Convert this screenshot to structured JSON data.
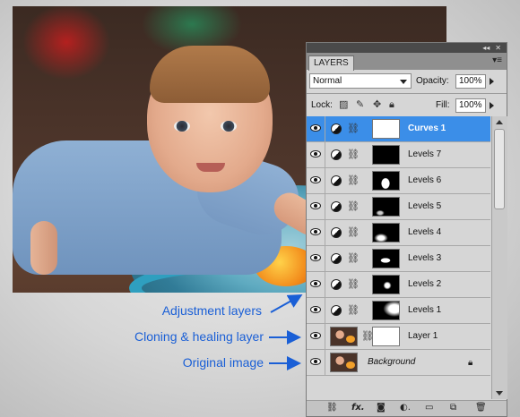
{
  "panel": {
    "tab_label": "LAYERS",
    "top_buttons": [
      "◂◂",
      "✕"
    ],
    "menu_icon": "panel-menu-icon",
    "blend_mode": "Normal",
    "opacity_label": "Opacity:",
    "opacity_value": "100%",
    "lock_label": "Lock:",
    "fill_label": "Fill:",
    "fill_value": "100%",
    "layers": [
      {
        "name": "Curves 1",
        "type": "adjustment",
        "selected": true,
        "mask": "white"
      },
      {
        "name": "Levels 7",
        "type": "adjustment",
        "selected": false,
        "mask": "black"
      },
      {
        "name": "Levels 6",
        "type": "adjustment",
        "selected": false,
        "mask": "black"
      },
      {
        "name": "Levels 5",
        "type": "adjustment",
        "selected": false,
        "mask": "black"
      },
      {
        "name": "Levels 4",
        "type": "adjustment",
        "selected": false,
        "mask": "black"
      },
      {
        "name": "Levels 3",
        "type": "adjustment",
        "selected": false,
        "mask": "black"
      },
      {
        "name": "Levels 2",
        "type": "adjustment",
        "selected": false,
        "mask": "black"
      },
      {
        "name": "Levels 1",
        "type": "adjustment",
        "selected": false,
        "mask": "black"
      },
      {
        "name": "Layer 1",
        "type": "pixel",
        "selected": false,
        "mask": "white"
      },
      {
        "name": "Background",
        "type": "background",
        "selected": false,
        "locked": true
      }
    ],
    "bottom_icons": [
      "link-layers-icon",
      "fx-icon",
      "add-mask-icon",
      "new-adjustment-icon",
      "new-group-icon",
      "new-layer-icon",
      "trash-icon"
    ]
  },
  "annotations": {
    "adjustment": "Adjustment layers",
    "cloning": "Cloning & healing layer",
    "original": "Original image"
  },
  "colors": {
    "annotation": "#1a5fd6",
    "selected_layer": "#3b8ee8"
  }
}
